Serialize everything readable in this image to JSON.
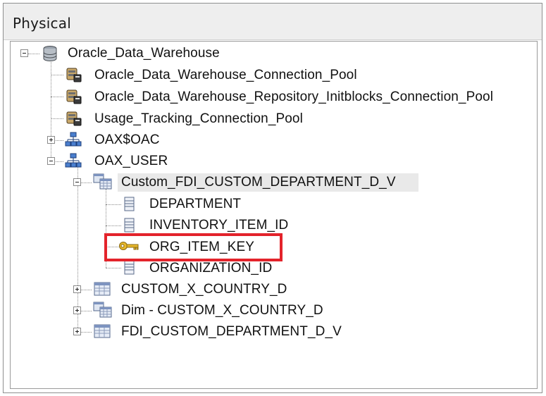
{
  "panel": {
    "title": "Physical"
  },
  "tree": {
    "database": {
      "label": "Oracle_Data_Warehouse",
      "icon": "database-icon",
      "expanded": true
    },
    "connection_pools": [
      {
        "label": "Oracle_Data_Warehouse_Connection_Pool",
        "icon": "connection-pool-icon"
      },
      {
        "label": "Oracle_Data_Warehouse_Repository_Initblocks_Connection_Pool",
        "icon": "connection-pool-icon"
      },
      {
        "label": "Usage_Tracking_Connection_Pool",
        "icon": "connection-pool-icon"
      }
    ],
    "schemas": [
      {
        "label": "OAX$OAC",
        "icon": "schema-icon",
        "expanded": false
      },
      {
        "label": "OAX_USER",
        "icon": "schema-icon",
        "expanded": true
      }
    ],
    "tables": [
      {
        "label": "Custom_FDI_CUSTOM_DEPARTMENT_D_V",
        "icon": "alias-table-icon",
        "expanded": true,
        "selected": true
      },
      {
        "label": "CUSTOM_X_COUNTRY_D",
        "icon": "table-icon",
        "expanded": false
      },
      {
        "label": "Dim - CUSTOM_X_COUNTRY_D",
        "icon": "alias-table-icon",
        "expanded": false
      },
      {
        "label": "FDI_CUSTOM_DEPARTMENT_D_V",
        "icon": "table-icon",
        "expanded": false
      }
    ],
    "columns": [
      {
        "label": "DEPARTMENT",
        "icon": "column-icon"
      },
      {
        "label": "INVENTORY_ITEM_ID",
        "icon": "column-icon"
      },
      {
        "label": "ORG_ITEM_KEY",
        "icon": "key-icon",
        "highlighted": true
      },
      {
        "label": "ORGANIZATION_ID",
        "icon": "column-icon"
      }
    ]
  },
  "colors": {
    "highlight_border": "#e3232b",
    "selection_bg": "#e9e9e9"
  }
}
